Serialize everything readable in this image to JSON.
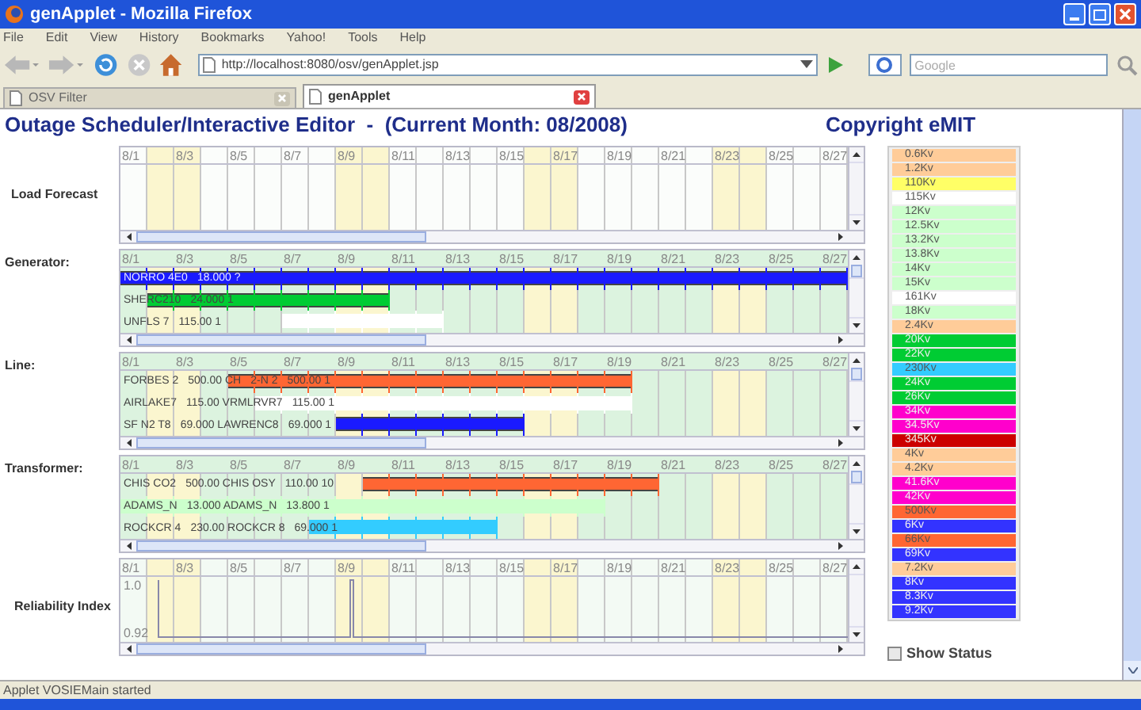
{
  "window": {
    "title": "genApplet - Mozilla Firefox"
  },
  "menu": [
    "File",
    "Edit",
    "View",
    "History",
    "Bookmarks",
    "Yahoo!",
    "Tools",
    "Help"
  ],
  "address": "http://localhost:8080/osv/genApplet.jsp",
  "search": {
    "placeholder": "Google"
  },
  "tabs": [
    {
      "label": "OSV Filter",
      "selected": false
    },
    {
      "label": "genApplet",
      "selected": true
    }
  ],
  "heading": "Outage Scheduler/Interactive Editor  -  (Current Month: 08/2008)",
  "copyright": "Copyright eMIT",
  "weekend_days": [
    false,
    true,
    true,
    false,
    false,
    false,
    false,
    false,
    true,
    true,
    false,
    false,
    false,
    false,
    false,
    true,
    true,
    false,
    false,
    false,
    false,
    false,
    true,
    true,
    false,
    false,
    false
  ],
  "panels": [
    {
      "kind": "forecast",
      "label": "Load Forecast",
      "dates": [
        "8/1",
        "8/3",
        "8/5",
        "8/7",
        "8/9",
        "8/11",
        "8/13",
        "8/15",
        "8/17",
        "8/19",
        "8/21",
        "8/23",
        "8/25",
        "8/27"
      ]
    },
    {
      "kind": "rows",
      "label": "Generator:",
      "dates": [
        "8/1",
        "8/3",
        "8/5",
        "8/7",
        "8/9",
        "8/11",
        "8/13",
        "8/15",
        "8/17",
        "8/19",
        "8/21",
        "8/23",
        "8/25",
        "8/27"
      ],
      "rows": [
        {
          "texts": [
            "NORRO 4E0",
            "18.000 ?"
          ],
          "bar": {
            "color": "#1a1aff",
            "days": [
              true,
              true,
              true,
              true,
              true,
              true,
              true,
              true,
              true,
              true,
              true,
              true,
              true,
              true,
              true,
              true,
              true,
              true,
              true,
              true,
              true,
              true,
              true,
              true,
              true,
              true,
              true
            ]
          }
        },
        {
          "texts": [
            "SHERC210",
            "24.000 1"
          ],
          "bar": {
            "color": "#00cc33",
            "days": [
              false,
              true,
              true,
              true,
              true,
              true,
              true,
              true,
              true,
              true,
              false,
              false,
              false,
              false,
              false,
              false,
              false,
              false,
              false,
              false,
              false,
              false,
              false,
              false,
              false,
              false,
              false
            ]
          }
        },
        {
          "texts": [
            "UNFLS 7",
            "115.00 1"
          ],
          "bar": {
            "color": "#ffffff",
            "days": [
              false,
              false,
              false,
              false,
              false,
              false,
              true,
              true,
              true,
              true,
              true,
              true,
              false,
              false,
              false,
              false,
              false,
              false,
              false,
              false,
              false,
              false,
              false,
              false,
              false,
              false,
              false
            ]
          }
        }
      ]
    },
    {
      "kind": "rows",
      "label": "Line:",
      "dates": [
        "8/1",
        "8/3",
        "8/5",
        "8/7",
        "8/9",
        "8/11",
        "8/13",
        "8/15",
        "8/17",
        "8/19",
        "8/21",
        "8/23",
        "8/25",
        "8/27"
      ],
      "rows": [
        {
          "texts": [
            "FORBES 2",
            "500.00 CH",
            "2-N 2",
            "500.00 1"
          ],
          "bar": {
            "color": "#ff6633",
            "days": [
              false,
              false,
              false,
              false,
              true,
              true,
              true,
              true,
              true,
              true,
              true,
              true,
              true,
              true,
              true,
              true,
              true,
              true,
              true,
              false,
              false,
              false,
              false,
              false,
              false,
              false,
              false
            ]
          }
        },
        {
          "texts": [
            "AIRLAKE7",
            "115.00 VRMLRVR7",
            "115.00 1"
          ],
          "bar": {
            "color": "#ffffff",
            "days": [
              false,
              false,
              false,
              false,
              false,
              true,
              true,
              true,
              true,
              true,
              true,
              true,
              true,
              true,
              true,
              true,
              true,
              true,
              true,
              false,
              false,
              false,
              false,
              false,
              false,
              false,
              false
            ]
          }
        },
        {
          "texts": [
            "SF N2 T8",
            "69.000 LAWRENC8",
            "69.000 1"
          ],
          "bar": {
            "color": "#1a1aff",
            "days": [
              false,
              false,
              false,
              false,
              false,
              false,
              false,
              false,
              true,
              true,
              true,
              true,
              true,
              true,
              true,
              false,
              false,
              false,
              false,
              false,
              false,
              false,
              false,
              false,
              false,
              false,
              false
            ]
          }
        }
      ]
    },
    {
      "kind": "rows",
      "label": "Transformer:",
      "dates": [
        "8/1",
        "8/3",
        "8/5",
        "8/7",
        "8/9",
        "8/11",
        "8/13",
        "8/15",
        "8/17",
        "8/19",
        "8/21",
        "8/23",
        "8/25",
        "8/27"
      ],
      "rows": [
        {
          "texts": [
            "CHIS CO2",
            "500.00 CHIS OSY",
            "110.00 10"
          ],
          "bar": {
            "color": "#ff6633",
            "days": [
              false,
              false,
              false,
              false,
              false,
              false,
              false,
              false,
              false,
              true,
              true,
              true,
              true,
              true,
              true,
              true,
              true,
              true,
              true,
              true,
              false,
              false,
              false,
              false,
              false,
              false,
              false
            ]
          }
        },
        {
          "texts": [
            "ADAMS_N",
            "13.000 ADAMS_N",
            "13.800 1"
          ],
          "bar": {
            "color": "#ccffcc",
            "days": [
              true,
              true,
              true,
              true,
              true,
              true,
              true,
              true,
              true,
              true,
              true,
              true,
              true,
              true,
              true,
              true,
              true,
              true,
              false,
              false,
              false,
              false,
              false,
              false,
              false,
              false,
              false
            ]
          }
        },
        {
          "texts": [
            "ROCKCR 4",
            "230.00 ROCKCR 8",
            "69.000 1"
          ],
          "bar": {
            "color": "#33ccff",
            "days": [
              false,
              false,
              false,
              false,
              false,
              false,
              false,
              true,
              true,
              true,
              true,
              true,
              true,
              true,
              false,
              false,
              false,
              false,
              false,
              false,
              false,
              false,
              false,
              false,
              false,
              false,
              false
            ]
          }
        }
      ]
    },
    {
      "kind": "reliability",
      "label": "Reliability Index",
      "dates": [
        "8/1",
        "8/3",
        "8/5",
        "8/7",
        "8/9",
        "8/11",
        "8/13",
        "8/15",
        "8/17",
        "8/19",
        "8/21",
        "8/23",
        "8/25",
        "8/27"
      ],
      "axis": [
        "1.0",
        "0.92"
      ]
    }
  ],
  "legend": [
    {
      "label": "0.6Kv",
      "color": "#ffcc99"
    },
    {
      "label": "1.2Kv",
      "color": "#ffcc99"
    },
    {
      "label": "110Kv",
      "color": "#ffff66"
    },
    {
      "label": "115Kv",
      "color": "#ffffff"
    },
    {
      "label": "12Kv",
      "color": "#ccffcc"
    },
    {
      "label": "12.5Kv",
      "color": "#ccffcc"
    },
    {
      "label": "13.2Kv",
      "color": "#ccffcc"
    },
    {
      "label": "13.8Kv",
      "color": "#ccffcc"
    },
    {
      "label": "14Kv",
      "color": "#ccffcc"
    },
    {
      "label": "15Kv",
      "color": "#ccffcc"
    },
    {
      "label": "161Kv",
      "color": "#ffffff"
    },
    {
      "label": "18Kv",
      "color": "#ccffcc"
    },
    {
      "label": "2.4Kv",
      "color": "#ffcc99"
    },
    {
      "label": "20Kv",
      "color": "#00cc33"
    },
    {
      "label": "22Kv",
      "color": "#00cc33"
    },
    {
      "label": "230Kv",
      "color": "#33ccff"
    },
    {
      "label": "24Kv",
      "color": "#00cc33"
    },
    {
      "label": "26Kv",
      "color": "#00cc33"
    },
    {
      "label": "34Kv",
      "color": "#ff00cc"
    },
    {
      "label": "34.5Kv",
      "color": "#ff00cc"
    },
    {
      "label": "345Kv",
      "color": "#cc0000"
    },
    {
      "label": "4Kv",
      "color": "#ffcc99"
    },
    {
      "label": "4.2Kv",
      "color": "#ffcc99"
    },
    {
      "label": "41.6Kv",
      "color": "#ff00cc"
    },
    {
      "label": "42Kv",
      "color": "#ff00cc"
    },
    {
      "label": "500Kv",
      "color": "#ff6633"
    },
    {
      "label": "6Kv",
      "color": "#3333ff"
    },
    {
      "label": "66Kv",
      "color": "#ff6633"
    },
    {
      "label": "69Kv",
      "color": "#3333ff"
    },
    {
      "label": "7.2Kv",
      "color": "#ffcc99"
    },
    {
      "label": "8Kv",
      "color": "#3333ff"
    },
    {
      "label": "8.3Kv",
      "color": "#3333ff"
    },
    {
      "label": "9.2Kv",
      "color": "#3333ff"
    }
  ],
  "show_status": {
    "label": "Show Status",
    "checked": false
  },
  "status_bar": "Applet VOSIEMain started"
}
